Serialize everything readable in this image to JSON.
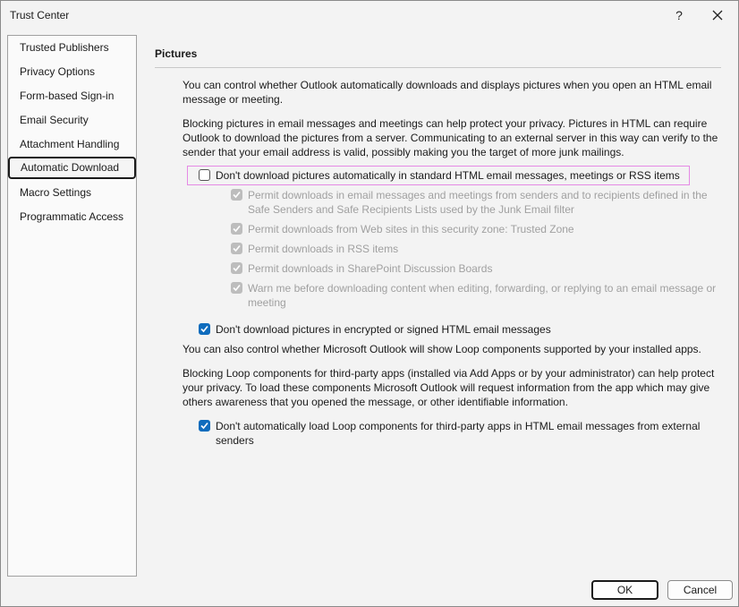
{
  "window": {
    "title": "Trust Center",
    "help_label": "?"
  },
  "sidebar": {
    "items": [
      {
        "label": "Trusted Publishers"
      },
      {
        "label": "Privacy Options"
      },
      {
        "label": "Form-based Sign-in"
      },
      {
        "label": "Email Security"
      },
      {
        "label": "Attachment Handling"
      },
      {
        "label": "Automatic Download",
        "active": true
      },
      {
        "label": "Macro Settings"
      },
      {
        "label": "Programmatic Access"
      }
    ]
  },
  "main": {
    "section_title": "Pictures",
    "intro_line1": "You can control whether Outlook automatically downloads and displays pictures when you open an HTML email",
    "intro_line2": "message or meeting.",
    "blocking_line1": "Blocking pictures in email messages and meetings can help protect your privacy. Pictures in HTML can require",
    "blocking_line2": "Outlook to download the pictures from a server. Communicating to an external server in this way can verify to the",
    "blocking_line3": "sender that your email address is valid, possibly making you the target of more junk mailings.",
    "dont_download": {
      "label": "Don't download pictures automatically in standard HTML email messages, meetings or RSS items",
      "checked": false
    },
    "sub_options": [
      {
        "line1": "Permit downloads in email messages and meetings from senders and to recipients defined in the",
        "line2": "Safe Senders and Safe Recipients Lists used by the Junk Email filter",
        "checked": true,
        "enabled": false
      },
      {
        "line1": "Permit downloads from Web sites in this security zone: Trusted Zone",
        "checked": true,
        "enabled": false
      },
      {
        "line1": "Permit downloads in RSS items",
        "checked": true,
        "enabled": false
      },
      {
        "line1": "Permit downloads in SharePoint Discussion Boards",
        "checked": true,
        "enabled": false
      },
      {
        "line1": "Warn me before downloading content when editing, forwarding, or replying to an email message or",
        "line2": "meeting",
        "checked": true,
        "enabled": false
      }
    ],
    "encrypted": {
      "label": "Don't download pictures in encrypted or signed HTML email messages",
      "checked": true
    },
    "loop_intro": "You can also control whether Microsoft Outlook will show Loop components supported by your installed apps.",
    "loop_line1": "Blocking Loop components for third-party apps (installed via Add Apps or by your administrator) can help protect",
    "loop_line2": "your privacy. To load these components Microsoft Outlook will request information from the app which may give",
    "loop_line3": "others awareness that you opened the message, or other identifiable information.",
    "loop_option": {
      "line1": "Don't automatically load Loop components for third-party apps in HTML email messages from external",
      "line2": "senders",
      "checked": true
    }
  },
  "buttons": {
    "ok": "OK",
    "cancel": "Cancel"
  },
  "colors": {
    "accent": "#0f6cbd",
    "highlight": "#e58ae5",
    "disabled_text": "#a0a0a0"
  }
}
